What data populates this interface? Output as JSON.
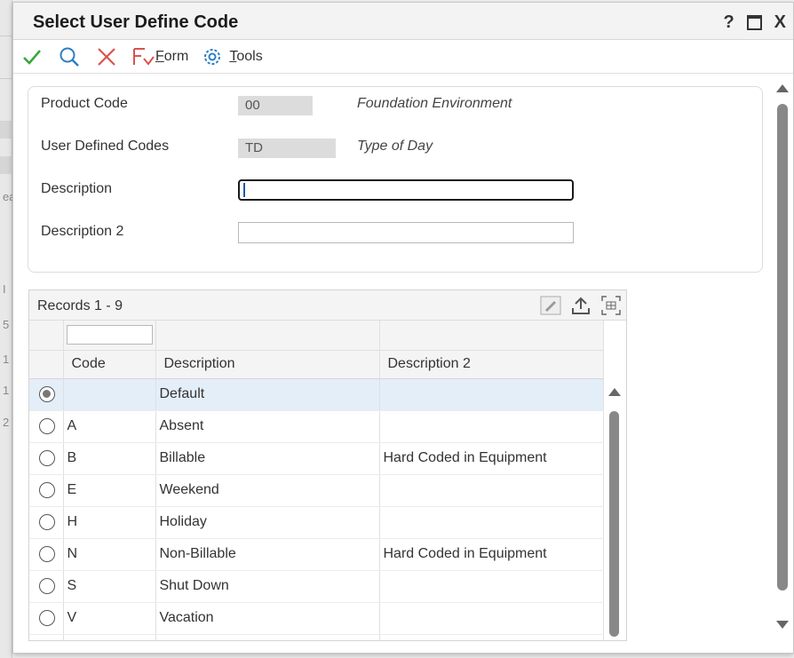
{
  "dialog": {
    "title": "Select User Define Code",
    "help_label": "?",
    "close_label": "X"
  },
  "toolbar": {
    "select_icon": "checkmark-icon",
    "find_icon": "search-icon",
    "cancel_icon": "close-icon",
    "form_prefix": "F",
    "form_rest": "orm",
    "tools_prefix": "T",
    "tools_rest": "ools",
    "colors": {
      "check": "#3aa63a",
      "search": "#2b7fc4",
      "cancel": "#d9534f"
    }
  },
  "header": {
    "product_code": {
      "label": "Product Code",
      "value": "00",
      "description": "Foundation Environment"
    },
    "udc": {
      "label": "User Defined Codes",
      "value": "TD",
      "description": "Type of Day"
    },
    "description": {
      "label": "Description",
      "value": ""
    },
    "description2": {
      "label": "Description 2",
      "value": ""
    }
  },
  "grid": {
    "records_label": "Records 1 - 9",
    "columns": [
      "Code",
      "Description",
      "Description 2"
    ],
    "rows": [
      {
        "code": "",
        "description": "Default",
        "description2": "",
        "selected": true
      },
      {
        "code": "A",
        "description": "Absent",
        "description2": ""
      },
      {
        "code": "B",
        "description": "Billable",
        "description2": "Hard Coded in Equipment"
      },
      {
        "code": "E",
        "description": "Weekend",
        "description2": ""
      },
      {
        "code": "H",
        "description": "Holiday",
        "description2": ""
      },
      {
        "code": "N",
        "description": "Non-Billable",
        "description2": "Hard Coded in Equipment"
      },
      {
        "code": "S",
        "description": "Shut Down",
        "description2": ""
      },
      {
        "code": "V",
        "description": "Vacation",
        "description2": ""
      }
    ]
  },
  "background": {
    "fragments": [
      "ea",
      "5",
      "1",
      "1",
      "2",
      "I"
    ]
  }
}
